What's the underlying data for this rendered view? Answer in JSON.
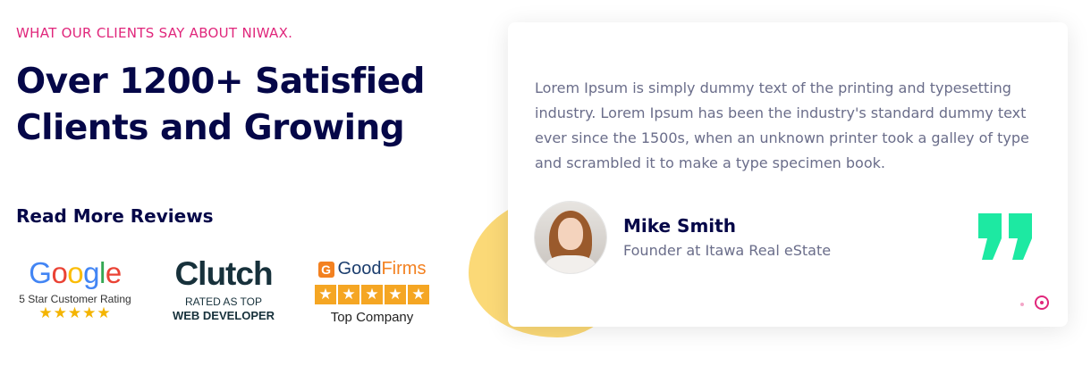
{
  "section": {
    "eyebrow": "WHAT OUR CLIENTS SAY ABOUT NIWAX.",
    "headline": "Over 1200+ Satisfied Clients and Growing",
    "reviews_title": "Read More Reviews"
  },
  "badges": {
    "google": {
      "letters": [
        "G",
        "o",
        "o",
        "g",
        "l",
        "e"
      ],
      "letter_colors": [
        "#4285f4",
        "#ea4335",
        "#fbbc05",
        "#4285f4",
        "#34a853",
        "#ea4335"
      ],
      "caption": "5 Star Customer Rating",
      "stars": "★★★★★"
    },
    "clutch": {
      "word": "Clutch",
      "sub1": "RATED AS TOP",
      "sub2": "WEB DEVELOPER"
    },
    "goodfirms": {
      "logo_letter": "G",
      "word_good": "Good",
      "word_firms": "Firms",
      "star": "★",
      "star_count": 5,
      "caption": "Top Company"
    }
  },
  "testimonial": {
    "text": "Lorem Ipsum is simply dummy text of the printing and typesetting industry. Lorem Ipsum has been the industry's standard dummy text ever since the 1500s, when an unknown printer took a galley of type and scrambled it to make a type specimen book.",
    "author_name": "Mike Smith",
    "author_role": "Founder at Itawa Real eState",
    "quote_icon": "quote-icon",
    "quote_color": "#1de9a2",
    "pagination_count": 2,
    "active_index": 1
  },
  "colors": {
    "accent": "#e0267b",
    "navy": "#050748",
    "blob": "#fbd977"
  }
}
